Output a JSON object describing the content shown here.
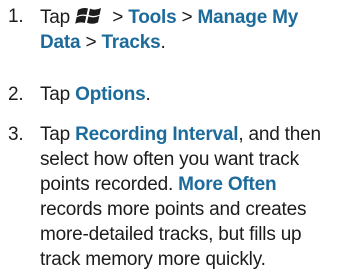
{
  "steps": [
    {
      "number": "1.",
      "tap": "Tap",
      "icon": "windows-start-icon",
      "sep1": " > ",
      "tools": "Tools",
      "sep2": " > ",
      "manage_l1": "Manage My",
      "manage_l2": "Data",
      "sep3": " > ",
      "tracks": "Tracks",
      "end": "."
    },
    {
      "number": "2.",
      "tap": "Tap ",
      "options": "Options",
      "end": "."
    },
    {
      "number": "3.",
      "tap": "Tap ",
      "recording_interval": "Recording Interval",
      "after_ri": ", and then",
      "line2": "select how often you want track",
      "line3": "points recorded.",
      "more_often": "More Often",
      "line4": "records more points and creates",
      "line5": "more-detailed tracks, but fills up",
      "line6": "track memory more quickly."
    }
  ],
  "colors": {
    "keyword": "#1d6b9b",
    "text": "#1c1c1c"
  }
}
